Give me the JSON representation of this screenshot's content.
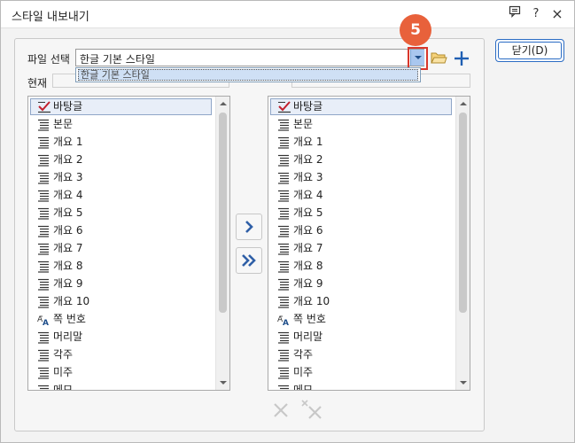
{
  "window": {
    "title": "스타일 내보내기",
    "help_label": "?",
    "close_label": "×"
  },
  "file_select": {
    "label": "파일 선택",
    "value": "한글 기본 스타일",
    "dropdown_option": "한글 기본 스타일"
  },
  "current_label": "현재",
  "annotation": {
    "step_number": "5"
  },
  "close_button_label": "닫기(D)",
  "left_list": [
    {
      "label": "바탕글",
      "icon": "checkmark-style-icon",
      "selected": true
    },
    {
      "label": "본문",
      "icon": "paragraph-style-icon"
    },
    {
      "label": "개요 1",
      "icon": "paragraph-style-icon"
    },
    {
      "label": "개요 2",
      "icon": "paragraph-style-icon"
    },
    {
      "label": "개요 3",
      "icon": "paragraph-style-icon"
    },
    {
      "label": "개요 4",
      "icon": "paragraph-style-icon"
    },
    {
      "label": "개요 5",
      "icon": "paragraph-style-icon"
    },
    {
      "label": "개요 6",
      "icon": "paragraph-style-icon"
    },
    {
      "label": "개요 7",
      "icon": "paragraph-style-icon"
    },
    {
      "label": "개요 8",
      "icon": "paragraph-style-icon"
    },
    {
      "label": "개요 9",
      "icon": "paragraph-style-icon"
    },
    {
      "label": "개요 10",
      "icon": "paragraph-style-icon"
    },
    {
      "label": "쪽 번호",
      "icon": "character-style-icon"
    },
    {
      "label": "머리말",
      "icon": "paragraph-style-icon"
    },
    {
      "label": "각주",
      "icon": "paragraph-style-icon"
    },
    {
      "label": "미주",
      "icon": "paragraph-style-icon"
    },
    {
      "label": "메모",
      "icon": "paragraph-style-icon"
    }
  ],
  "right_list": [
    {
      "label": "바탕글",
      "icon": "checkmark-style-icon",
      "selected": true
    },
    {
      "label": "본문",
      "icon": "paragraph-style-icon"
    },
    {
      "label": "개요 1",
      "icon": "paragraph-style-icon"
    },
    {
      "label": "개요 2",
      "icon": "paragraph-style-icon"
    },
    {
      "label": "개요 3",
      "icon": "paragraph-style-icon"
    },
    {
      "label": "개요 4",
      "icon": "paragraph-style-icon"
    },
    {
      "label": "개요 5",
      "icon": "paragraph-style-icon"
    },
    {
      "label": "개요 6",
      "icon": "paragraph-style-icon"
    },
    {
      "label": "개요 7",
      "icon": "paragraph-style-icon"
    },
    {
      "label": "개요 8",
      "icon": "paragraph-style-icon"
    },
    {
      "label": "개요 9",
      "icon": "paragraph-style-icon"
    },
    {
      "label": "개요 10",
      "icon": "paragraph-style-icon"
    },
    {
      "label": "쪽 번호",
      "icon": "character-style-icon"
    },
    {
      "label": "머리말",
      "icon": "paragraph-style-icon"
    },
    {
      "label": "각주",
      "icon": "paragraph-style-icon"
    },
    {
      "label": "미주",
      "icon": "paragraph-style-icon"
    },
    {
      "label": "메모",
      "icon": "paragraph-style-icon"
    }
  ],
  "colors": {
    "accent": "#2b6cc4",
    "annotation": "#e8613b",
    "highlight_border": "#d9372c",
    "dropdown_button": "#a9c7ef"
  }
}
